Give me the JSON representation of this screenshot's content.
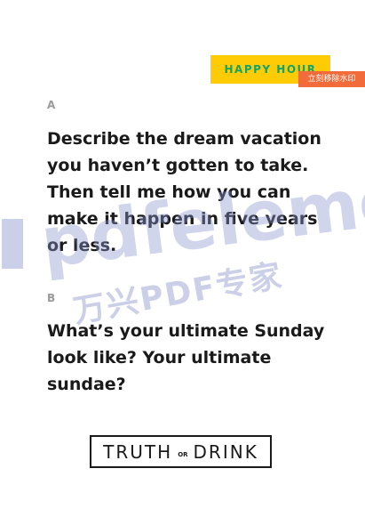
{
  "badge": {
    "label": "HAPPY HOUR",
    "bg_color": "#FFCB05",
    "text_color": "#12A46B"
  },
  "watermark": {
    "remove_label": "立刻移除水印",
    "remove_color": "#F26B3A",
    "brand_text": "pdfelement",
    "cn_text": "万兴PDF专家",
    "color": "#8C96CD"
  },
  "questions": [
    {
      "letter": "A",
      "lines": [
        "Describe the dream vacation",
        "you haven’t gotten to take.",
        "Then tell me how you can",
        "make it happen in five years",
        "or less."
      ]
    },
    {
      "letter": "B",
      "lines": [
        "What’s your ultimate Sunday",
        "look like? Your ultimate",
        "sundae?"
      ]
    }
  ],
  "logo": {
    "left_word": "TRUTH",
    "or_word": "OR",
    "right_word": "DRINK"
  }
}
